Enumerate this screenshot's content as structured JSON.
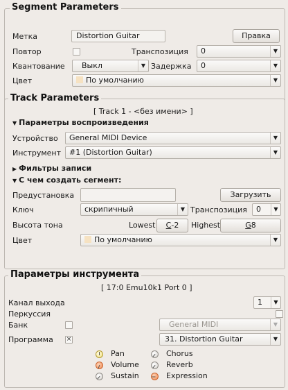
{
  "segment": {
    "title": "Segment Parameters",
    "label_label": "Метка",
    "label_value": "Distortion Guitar",
    "edit_button": "Правка",
    "repeat_label": "Повтор",
    "repeat_checked": false,
    "transpose_label": "Транспозиция",
    "transpose_value": "0",
    "quantize_label": "Квантование",
    "quantize_value": "Выкл",
    "delay_label": "Задержка",
    "delay_value": "0",
    "color_label": "Цвет",
    "color_value": "По умолчанию"
  },
  "track": {
    "title": "Track Parameters",
    "track_name": "[ Track 1 - <без имени> ]",
    "playback_section": "Параметры воспроизведения",
    "device_label": "Устройство",
    "device_value": "General MIDI Device",
    "instrument_label": "Инструмент",
    "instrument_value": "#1 (Distortion Guitar)",
    "record_filters_section": "Фильтры записи",
    "create_segments_section": "С чем создать сегмент:",
    "preset_label": "Предустановка",
    "preset_value": "",
    "load_button": "Загрузить",
    "clef_label": "Ключ",
    "clef_value": "скрипичный",
    "transpose_label": "Транспозиция",
    "transpose_value": "0",
    "pitch_label": "Высота тона",
    "lowest_label": "Lowest",
    "lowest_value_underline": "C",
    "lowest_value_rest": "-2",
    "highest_label": "Highest",
    "highest_value_underline": "G",
    "highest_value_rest": "8",
    "color_label": "Цвет",
    "color_value": "По умолчанию"
  },
  "instrument": {
    "title": "Параметры инструмента",
    "port_name": "[ 17:0 Emu10k1 Port 0 ]",
    "out_channel_label": "Канал выхода",
    "out_channel_value": "1",
    "percussion_label": "Перкуссия",
    "bank_label": "Банк",
    "bank_value": "General MIDI",
    "program_label": "Программа",
    "program_checked": true,
    "program_value": "31. Distortion Guitar",
    "controllers": {
      "pan": "Pan",
      "volume": "Volume",
      "sustain": "Sustain",
      "chorus": "Chorus",
      "reverb": "Reverb",
      "expression": "Expression"
    }
  },
  "icons": {
    "dropdown": "triangle-down",
    "expanded": "triangle-down",
    "collapsed": "triangle-right",
    "checked": "x-mark"
  }
}
